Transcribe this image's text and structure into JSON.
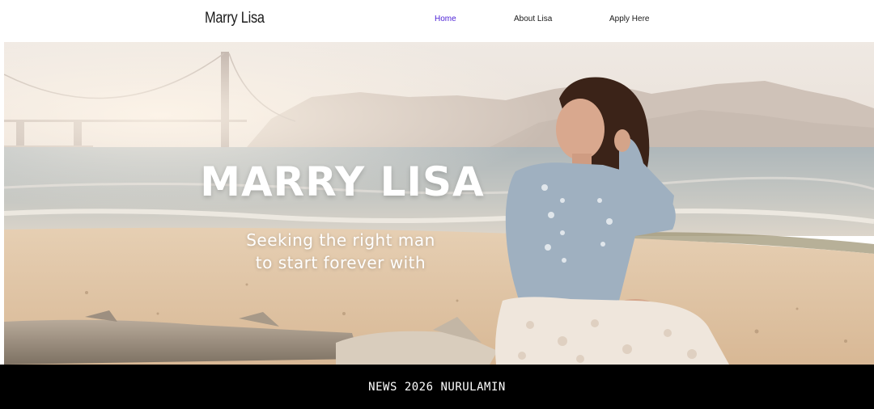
{
  "header": {
    "logo": "Marry Lisa",
    "nav": [
      {
        "label": "Home",
        "active": true
      },
      {
        "label": "About Lisa",
        "active": false
      },
      {
        "label": "Apply Here",
        "active": false
      }
    ],
    "active_color": "#4b1fd6"
  },
  "hero": {
    "title": "MARRY LISA",
    "subtitle_line1": "Seeking the right man",
    "subtitle_line2": "to start forever with"
  },
  "footer": {
    "text": "NEWS 2026 NURULAMIN"
  }
}
